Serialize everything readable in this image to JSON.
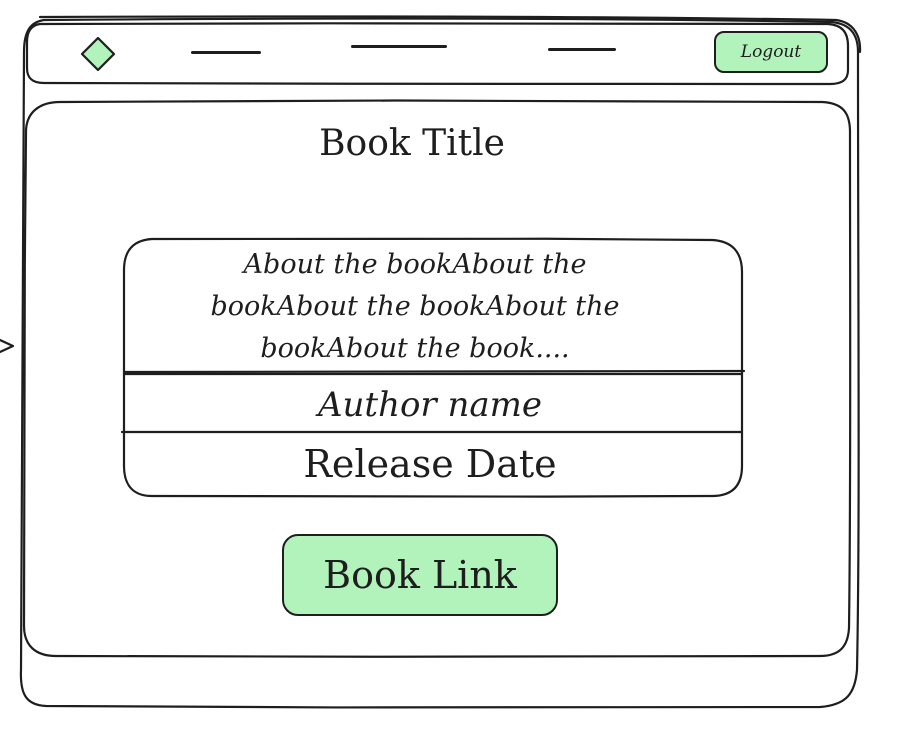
{
  "window": {
    "logout_label": "Logout"
  },
  "book": {
    "title": "Book Title",
    "about": "About the bookAbout the bookAbout the bookAbout the bookAbout the book....",
    "author": "Author name",
    "release_date": "Release Date",
    "link_label": "Book Link"
  },
  "colors": {
    "accent": "#b2f2bb",
    "stroke": "#1e1e1e",
    "background": "#ffffff"
  },
  "icons": {
    "logo": "diamond-logo-icon"
  }
}
